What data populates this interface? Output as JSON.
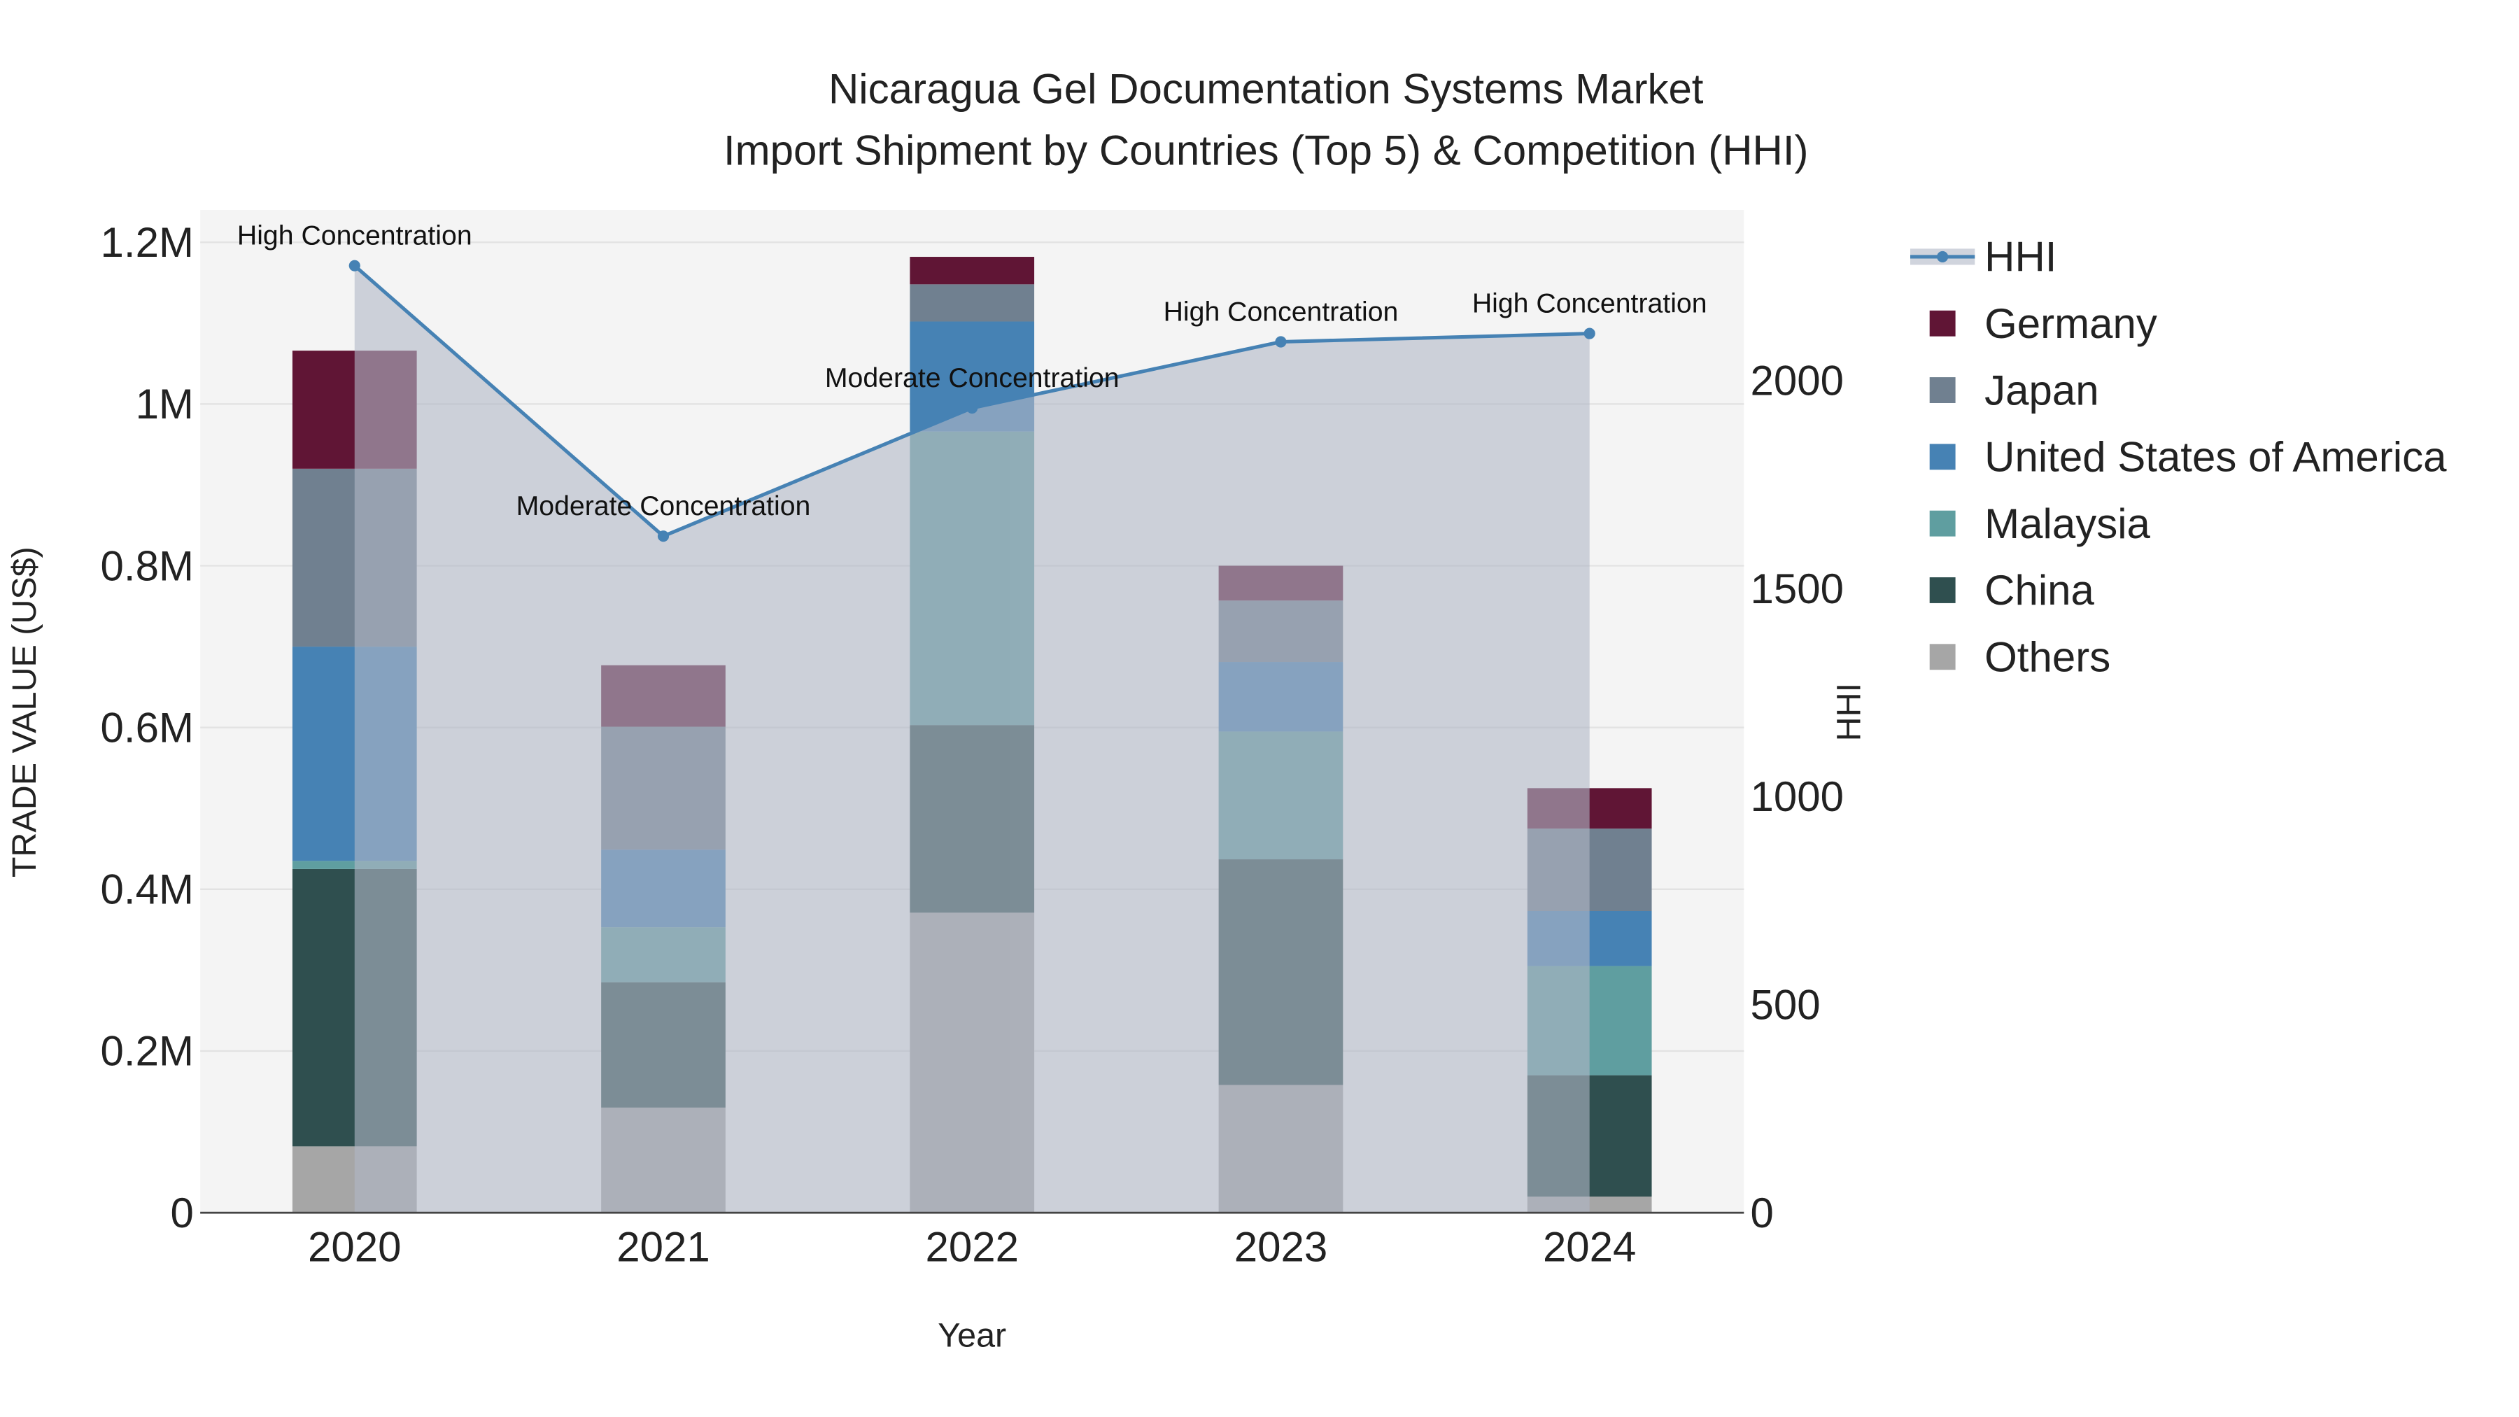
{
  "chart_data": {
    "type": "bar",
    "title": "Nicaragua Gel Documentation Systems Market",
    "subtitle": "Import Shipment by Countries (Top 5) & Competition (HHI)",
    "xlabel": "Year",
    "ylabel": "TRADE VALUE (US$)",
    "y2label": "HHI",
    "categories": [
      "2020",
      "2021",
      "2022",
      "2023",
      "2024"
    ],
    "ylim": [
      0,
      1240000
    ],
    "y2lim": [
      0,
      2410
    ],
    "yticks": [
      {
        "v": 0,
        "label": "0"
      },
      {
        "v": 200000,
        "label": "0.2M"
      },
      {
        "v": 400000,
        "label": "0.4M"
      },
      {
        "v": 600000,
        "label": "0.6M"
      },
      {
        "v": 800000,
        "label": "0.8M"
      },
      {
        "v": 1000000,
        "label": "1M"
      },
      {
        "v": 1200000,
        "label": "1.2M"
      }
    ],
    "y2ticks": [
      {
        "v": 0,
        "label": "0"
      },
      {
        "v": 500,
        "label": "500"
      },
      {
        "v": 1000,
        "label": "1000"
      },
      {
        "v": 1500,
        "label": "1500"
      },
      {
        "v": 2000,
        "label": "2000"
      }
    ],
    "series": [
      {
        "name": "Others",
        "color": "#a6a6a6",
        "values": [
          82000,
          130000,
          371000,
          158000,
          20000
        ]
      },
      {
        "name": "China",
        "color": "#2f4f4f",
        "values": [
          343000,
          155000,
          232000,
          279000,
          150000
        ]
      },
      {
        "name": "Malaysia",
        "color": "#5f9ea0",
        "values": [
          10000,
          68000,
          363000,
          158000,
          135000
        ]
      },
      {
        "name": "United States of America",
        "color": "#4682b4",
        "values": [
          265000,
          96000,
          136000,
          86000,
          68000
        ]
      },
      {
        "name": "Japan",
        "color": "#708090",
        "values": [
          220000,
          152000,
          46000,
          76000,
          102000
        ]
      },
      {
        "name": "Germany",
        "color": "#601535",
        "values": [
          146000,
          76000,
          34000,
          43000,
          50000
        ]
      }
    ],
    "hhi": {
      "name": "HHI",
      "color": "#4682b4",
      "values": [
        2276,
        1626,
        1934,
        2093,
        2113
      ],
      "annotations": [
        "High Concentration",
        "Moderate Concentration",
        "Moderate Concentration",
        "High Concentration",
        "High Concentration"
      ]
    },
    "legend_order": [
      "HHI",
      "Germany",
      "Japan",
      "United States of America",
      "Malaysia",
      "China",
      "Others"
    ],
    "legend_position": "right",
    "grid": true
  }
}
